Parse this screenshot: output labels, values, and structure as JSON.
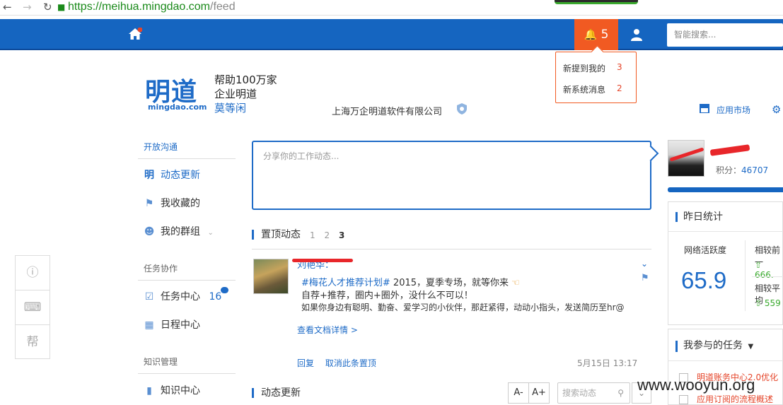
{
  "browser": {
    "back_icon": "arrow-left",
    "forward_icon": "arrow-right",
    "reload_icon": "reload",
    "lock_icon": "lock",
    "url_scheme": "https://",
    "url_host": "meihua.mingdao.com",
    "url_path": "/feed"
  },
  "topbar": {
    "home_icon": "home",
    "notifications_count": "5",
    "user_icon": "user",
    "search_placeholder": "智能搜索..."
  },
  "notifications_dropdown": {
    "items": [
      {
        "label": "新提到我的",
        "count": "3"
      },
      {
        "label": "新系统消息",
        "count": "2"
      }
    ]
  },
  "brand": {
    "logo_text": "明道",
    "logo_sub": "mingdao.com",
    "slogan_line1": "帮助100万家",
    "slogan_line2": "企业明道",
    "slogan_line3": "莫等闲"
  },
  "company": {
    "name": "上海万企明道软件有限公司",
    "app_market": "应用市场"
  },
  "sidebar": {
    "section1": "开放沟通",
    "items1": [
      "动态更新",
      "我收藏的",
      "我的群组"
    ],
    "section2": "任务协作",
    "task_center": "任务中心",
    "task_count": "16",
    "calendar": "日程中心",
    "section3": "知识管理",
    "knowledge": "知识中心"
  },
  "left_tools": {
    "help_label": "帮"
  },
  "share": {
    "placeholder": "分享你的工作动态..."
  },
  "pinned": {
    "title": "置顶动态",
    "pages": [
      "1",
      "2",
      "3"
    ],
    "current_page": "3"
  },
  "post": {
    "author": "刘艳华：",
    "tag": "#梅花人才推荐计划#",
    "line1_rest": " 2015，夏季专场，就等你来",
    "line2": "自荐+推荐，圈内+圈外，没什么不可以！",
    "line3": "如果你身边有聪明、勤奋、爱学习的小伙伴，那赶紧得，动动小指头，发送简历至hr@",
    "link": "查看文档详情 >",
    "reply": "回复",
    "unpin": "取消此条置顶",
    "time": "5月15日 13:17"
  },
  "feed_updates": {
    "title": "动态更新",
    "font_minus": "A-",
    "font_plus": "A+",
    "search_placeholder": "搜索动态"
  },
  "profile": {
    "score_label": "积分：",
    "score_value": "46707"
  },
  "yesterday_stats": {
    "title": "昨日统计",
    "activity_label": "网络活跃度",
    "activity_value": "65.9",
    "compare1_label": "相较前一",
    "compare1_value": "666.",
    "compare2_label": "相较平均",
    "compare2_value": "559"
  },
  "my_tasks": {
    "title": "我参与的任务",
    "items": [
      "明道账务中心2.0优化",
      "应用订阅的流程概述"
    ]
  },
  "watermark": "www.wooyun.org",
  "colors": {
    "brand_blue": "#1565c0",
    "notification_orange": "#f15a22",
    "link_blue": "#1e6bc7",
    "count_red": "#e5452a",
    "green_up": "#3aaa2e"
  }
}
